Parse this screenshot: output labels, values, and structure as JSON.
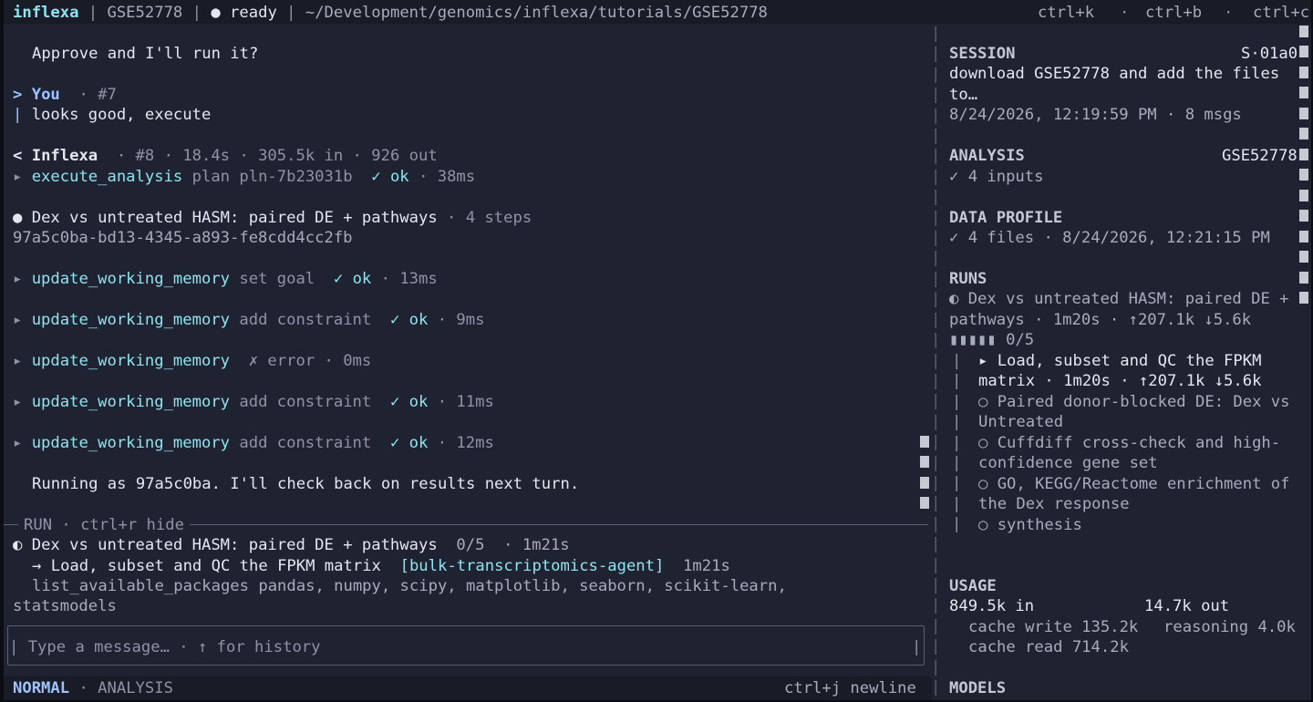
{
  "topbar": {
    "app": "inflexa",
    "dataset": "GSE52778",
    "status_dot": "●",
    "status": "ready",
    "path": "~/Development/genomics/inflexa/tutorials/GSE52778",
    "shortcuts": [
      "ctrl+k",
      "ctrl+b",
      "ctrl+c"
    ]
  },
  "chat": {
    "approve_line": "Approve and I'll run it?",
    "user_turn": {
      "marker": ">",
      "name": "You",
      "meta": "· #7",
      "text": "looks good, execute"
    },
    "assistant_turn": {
      "marker": "<",
      "name": "Inflexa",
      "meta": "· #8 · 18.4s · 305.5k in · 926 out"
    },
    "execute_tool": {
      "name": "execute_analysis",
      "args": "plan pln-7b23031b",
      "result": "✓ ok",
      "time": "· 38ms"
    },
    "plan": {
      "dot": "●",
      "title": "Dex vs untreated HASM: paired DE + pathways",
      "steps": "· 4 steps",
      "id": "97a5c0ba-bd13-4345-a893-fe8cdd4cc2fb"
    },
    "tool_calls": [
      {
        "name": "update_working_memory",
        "args": "set goal",
        "result": "✓ ok",
        "time": "· 13ms",
        "error": false
      },
      {
        "name": "update_working_memory",
        "args": "add constraint",
        "result": "✓ ok",
        "time": "· 9ms",
        "error": false
      },
      {
        "name": "update_working_memory",
        "args": "",
        "result": "✗ error",
        "time": "· 0ms",
        "error": true
      },
      {
        "name": "update_working_memory",
        "args": "add constraint",
        "result": "✓ ok",
        "time": "· 11ms",
        "error": false
      },
      {
        "name": "update_working_memory",
        "args": "add constraint",
        "result": "✓ ok",
        "time": "· 12ms",
        "error": false
      }
    ],
    "closing": "Running as 97a5c0ba. I'll check back on results next turn."
  },
  "run_panel": {
    "header": "RUN · ctrl+r hide",
    "title_icon": "◐",
    "title": "Dex vs untreated HASM: paired DE + pathways",
    "progress": "0/5",
    "time": "· 1m21s",
    "step_arrow": "→",
    "step": "Load, subset and QC the FPKM matrix",
    "agent": "[bulk-transcriptomics-agent]",
    "step_time": "1m21s",
    "log_line1": "list_available_packages pandas, numpy, scipy, matplotlib, seaborn, scikit-learn,",
    "log_line2": "statsmodels"
  },
  "input": {
    "placeholder": "Type a message… · ↑ for history"
  },
  "statusbar": {
    "mode": "NORMAL",
    "sub": "· ANALYSIS",
    "hint": "ctrl+j newline"
  },
  "sidebar": {
    "session": {
      "label": "SESSION",
      "id": "S·01a0",
      "desc1": "download GSE52778 and add the files",
      "desc2": "to…",
      "date": "8/24/2026, 12:19:59 PM · 8 msgs"
    },
    "analysis": {
      "label": "ANALYSIS",
      "id": "GSE52778",
      "inputs": "✓ 4 inputs"
    },
    "data_profile": {
      "label": "DATA PROFILE",
      "summary": "✓ 4 files · 8/24/2026, 12:21:15 PM"
    },
    "runs": {
      "label": "RUNS",
      "line1": "◐ Dex vs untreated HASM: paired DE +",
      "line2": "pathways · 1m20s · ↑207.1k ↓5.6k",
      "progress_text": "▮▮▮▮▮ 0/5",
      "steps": [
        {
          "l1": "▸ Load, subset and QC the FPKM",
          "l2": "matrix · 1m20s · ↑207.1k ↓5.6k"
        },
        {
          "l1": "○ Paired donor-blocked DE: Dex vs",
          "l2": "Untreated"
        },
        {
          "l1": "○ Cuffdiff cross-check and high-",
          "l2": "confidence gene set"
        },
        {
          "l1": "○ GO, KEGG/Reactome enrichment of",
          "l2": "the Dex response"
        },
        {
          "l1": "○ synthesis",
          "l2": ""
        }
      ]
    },
    "usage": {
      "label": "USAGE",
      "in": "849.5k in",
      "out": "14.7k out",
      "cache_write": "cache write 135.2k",
      "reasoning": "reasoning 4.0k",
      "cache_read": "cache read 714.2k"
    },
    "models": {
      "label": "MODELS"
    }
  },
  "colors": {
    "bg": "#1f2231",
    "accent": "#8fe3ef",
    "you": "#9ec2ff"
  }
}
